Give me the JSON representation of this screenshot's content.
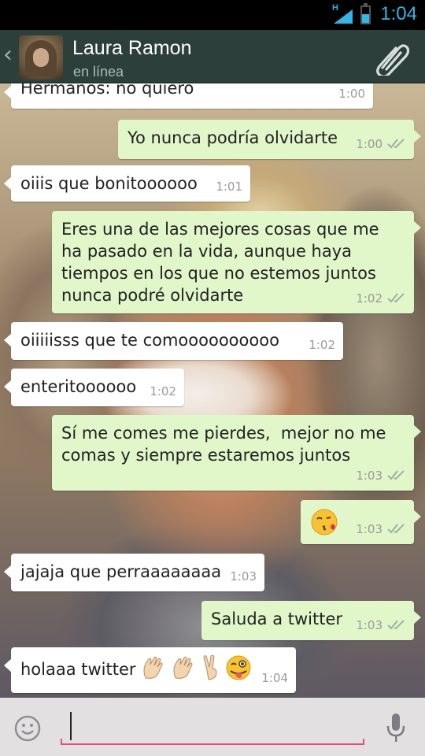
{
  "status_bar": {
    "network": "H",
    "time": "1:04"
  },
  "header": {
    "back_icon": "chevron-left-icon",
    "contact_name": "Laura Ramon",
    "contact_status": "en línea",
    "attach_icon": "paperclip-icon"
  },
  "messages": [
    {
      "direction": "in",
      "text": "Hermanos: no quiero",
      "time": "1:00"
    },
    {
      "direction": "out",
      "text": "Yo nunca podría olvidarte",
      "time": "1:00"
    },
    {
      "direction": "in",
      "text": "oiiis que bonitoooooo",
      "time": "1:01"
    },
    {
      "direction": "out",
      "text": "Eres una de las mejores cosas que me ha pasado en la vida, aunque haya tiempos en los que no estemos juntos nunca podré olvidarte",
      "time": "1:02"
    },
    {
      "direction": "in",
      "text": "oiiiiisss que te comoooooooooo",
      "time": "1:02"
    },
    {
      "direction": "in",
      "text": "enteritoooooo",
      "time": "1:02"
    },
    {
      "direction": "out",
      "text": "Sí me comes me pierdes,  mejor no me comas y siempre estaremos juntos",
      "time": "1:03"
    },
    {
      "direction": "out",
      "text": "",
      "emoji": "kissing-heart-emoji",
      "time": "1:03"
    },
    {
      "direction": "in",
      "text": "jajaja que perraaaaaaaa",
      "time": "1:03"
    },
    {
      "direction": "out",
      "text": "Saluda a twitter",
      "time": "1:03"
    },
    {
      "direction": "in",
      "text": "holaaa twitter",
      "emoji": "waving-hands-victory-winking-tongue-emoji",
      "time": "1:04"
    }
  ],
  "input_bar": {
    "emoji_icon": "smiley-icon",
    "placeholder": "",
    "mic_icon": "microphone-icon"
  }
}
